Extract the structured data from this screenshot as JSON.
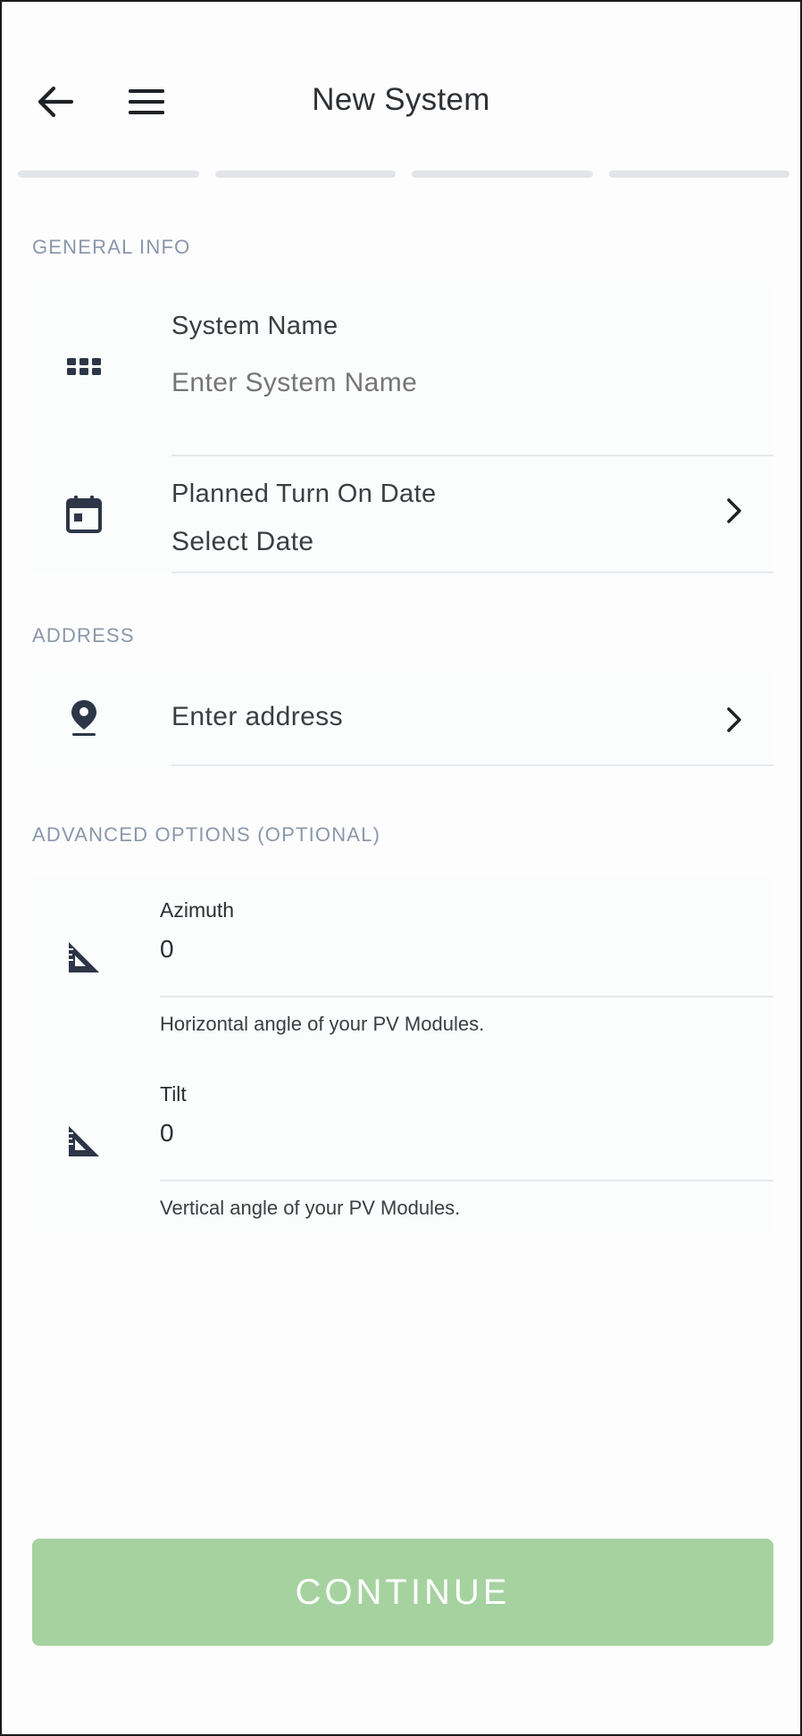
{
  "header": {
    "title": "New System",
    "back_icon": "arrow-left-icon",
    "menu_icon": "hamburger-menu-icon"
  },
  "progress": {
    "steps": 4,
    "current": 0
  },
  "general_info": {
    "section_label": "GENERAL INFO",
    "system_name": {
      "label": "System Name",
      "placeholder": "Enter System Name",
      "value": "",
      "icon": "grid-icon"
    },
    "turn_on_date": {
      "label": "Planned Turn On Date",
      "value": "Select Date",
      "icon": "calendar-icon"
    }
  },
  "address": {
    "section_label": "ADDRESS",
    "value": "Enter address",
    "icon": "map-pin-icon"
  },
  "advanced": {
    "section_label": "ADVANCED OPTIONS (OPTIONAL)",
    "azimuth": {
      "label": "Azimuth",
      "value": "0",
      "help": "Horizontal angle of your PV Modules.",
      "icon": "set-square-icon"
    },
    "tilt": {
      "label": "Tilt",
      "value": "0",
      "help": "Vertical angle of your PV Modules.",
      "icon": "set-square-icon"
    }
  },
  "continue_label": "CONTINUE",
  "colors": {
    "accent_disabled": "#a6d2a0",
    "section_label": "#8a97ab",
    "progress_inactive": "#e2e5e9",
    "icon": "#2c3647"
  }
}
